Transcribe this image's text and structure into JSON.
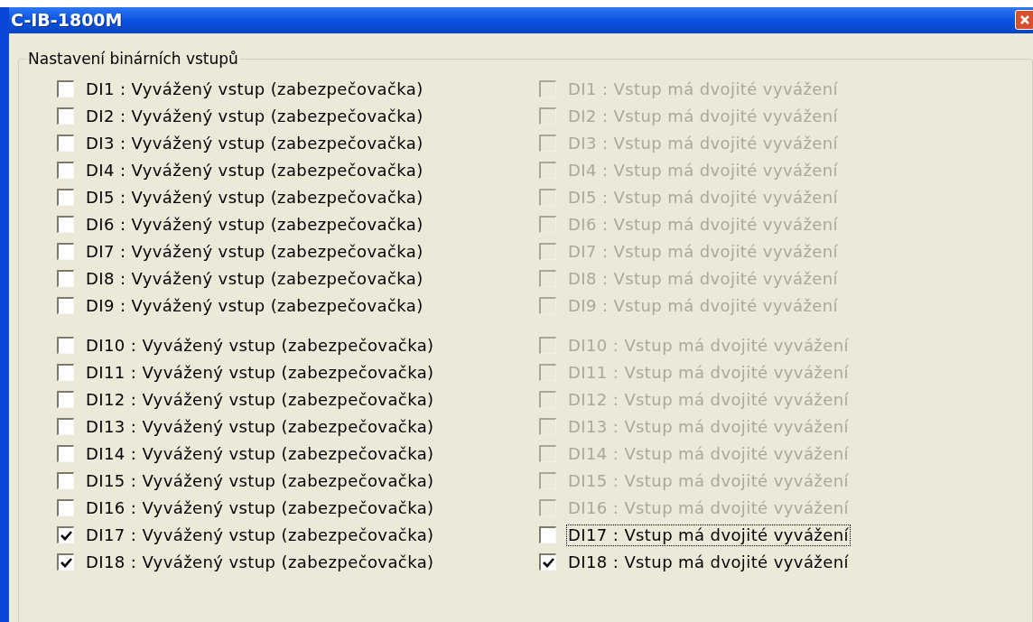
{
  "window": {
    "title": "C-IB-1800M"
  },
  "group": {
    "title": "Nastavení binárních vstupů",
    "sections": [
      {
        "rows": [
          {
            "left": {
              "label": "DI1 : Vyvážený vstup (zabezpečovačka)",
              "checked": false,
              "disabled": false
            },
            "right": {
              "label": "DI1 : Vstup má dvojité vyvážení",
              "checked": false,
              "disabled": true,
              "focused": false
            }
          },
          {
            "left": {
              "label": "DI2 : Vyvážený vstup (zabezpečovačka)",
              "checked": false,
              "disabled": false
            },
            "right": {
              "label": "DI2 : Vstup má dvojité vyvážení",
              "checked": false,
              "disabled": true,
              "focused": false
            }
          },
          {
            "left": {
              "label": "DI3 : Vyvážený vstup (zabezpečovačka)",
              "checked": false,
              "disabled": false
            },
            "right": {
              "label": "DI3 : Vstup má dvojité vyvážení",
              "checked": false,
              "disabled": true,
              "focused": false
            }
          },
          {
            "left": {
              "label": "DI4 : Vyvážený vstup (zabezpečovačka)",
              "checked": false,
              "disabled": false
            },
            "right": {
              "label": "DI4 : Vstup má dvojité vyvážení",
              "checked": false,
              "disabled": true,
              "focused": false
            }
          },
          {
            "left": {
              "label": "DI5 : Vyvážený vstup (zabezpečovačka)",
              "checked": false,
              "disabled": false
            },
            "right": {
              "label": "DI5 : Vstup má dvojité vyvážení",
              "checked": false,
              "disabled": true,
              "focused": false
            }
          },
          {
            "left": {
              "label": "DI6 : Vyvážený vstup (zabezpečovačka)",
              "checked": false,
              "disabled": false
            },
            "right": {
              "label": "DI6 : Vstup má dvojité vyvážení",
              "checked": false,
              "disabled": true,
              "focused": false
            }
          },
          {
            "left": {
              "label": "DI7 : Vyvážený vstup (zabezpečovačka)",
              "checked": false,
              "disabled": false
            },
            "right": {
              "label": "DI7 : Vstup má dvojité vyvážení",
              "checked": false,
              "disabled": true,
              "focused": false
            }
          },
          {
            "left": {
              "label": "DI8 : Vyvážený vstup (zabezpečovačka)",
              "checked": false,
              "disabled": false
            },
            "right": {
              "label": "DI8 : Vstup má dvojité vyvážení",
              "checked": false,
              "disabled": true,
              "focused": false
            }
          },
          {
            "left": {
              "label": "DI9 : Vyvážený vstup (zabezpečovačka)",
              "checked": false,
              "disabled": false
            },
            "right": {
              "label": "DI9 : Vstup má dvojité vyvážení",
              "checked": false,
              "disabled": true,
              "focused": false
            }
          }
        ]
      },
      {
        "rows": [
          {
            "left": {
              "label": "DI10 : Vyvážený vstup (zabezpečovačka)",
              "checked": false,
              "disabled": false
            },
            "right": {
              "label": "DI10 : Vstup má dvojité vyvážení",
              "checked": false,
              "disabled": true,
              "focused": false
            }
          },
          {
            "left": {
              "label": "DI11 : Vyvážený vstup (zabezpečovačka)",
              "checked": false,
              "disabled": false
            },
            "right": {
              "label": "DI11 : Vstup má dvojité vyvážení",
              "checked": false,
              "disabled": true,
              "focused": false
            }
          },
          {
            "left": {
              "label": "DI12 : Vyvážený vstup (zabezpečovačka)",
              "checked": false,
              "disabled": false
            },
            "right": {
              "label": "DI12 : Vstup má dvojité vyvážení",
              "checked": false,
              "disabled": true,
              "focused": false
            }
          },
          {
            "left": {
              "label": "DI13 : Vyvážený vstup (zabezpečovačka)",
              "checked": false,
              "disabled": false
            },
            "right": {
              "label": "DI13 : Vstup má dvojité vyvážení",
              "checked": false,
              "disabled": true,
              "focused": false
            }
          },
          {
            "left": {
              "label": "DI14 : Vyvážený vstup (zabezpečovačka)",
              "checked": false,
              "disabled": false
            },
            "right": {
              "label": "DI14 : Vstup má dvojité vyvážení",
              "checked": false,
              "disabled": true,
              "focused": false
            }
          },
          {
            "left": {
              "label": "DI15 : Vyvážený vstup (zabezpečovačka)",
              "checked": false,
              "disabled": false
            },
            "right": {
              "label": "DI15 : Vstup má dvojité vyvážení",
              "checked": false,
              "disabled": true,
              "focused": false
            }
          },
          {
            "left": {
              "label": "DI16 : Vyvážený vstup (zabezpečovačka)",
              "checked": false,
              "disabled": false
            },
            "right": {
              "label": "DI16 : Vstup má dvojité vyvážení",
              "checked": false,
              "disabled": true,
              "focused": false
            }
          },
          {
            "left": {
              "label": "DI17 : Vyvážený vstup (zabezpečovačka)",
              "checked": true,
              "disabled": false
            },
            "right": {
              "label": "DI17 : Vstup má dvojité vyvážení",
              "checked": false,
              "disabled": false,
              "focused": true
            }
          },
          {
            "left": {
              "label": "DI18 : Vyvážený vstup (zabezpečovačka)",
              "checked": true,
              "disabled": false
            },
            "right": {
              "label": "DI18 : Vstup má dvojité vyvážení",
              "checked": true,
              "disabled": false,
              "focused": false
            }
          }
        ]
      }
    ]
  }
}
